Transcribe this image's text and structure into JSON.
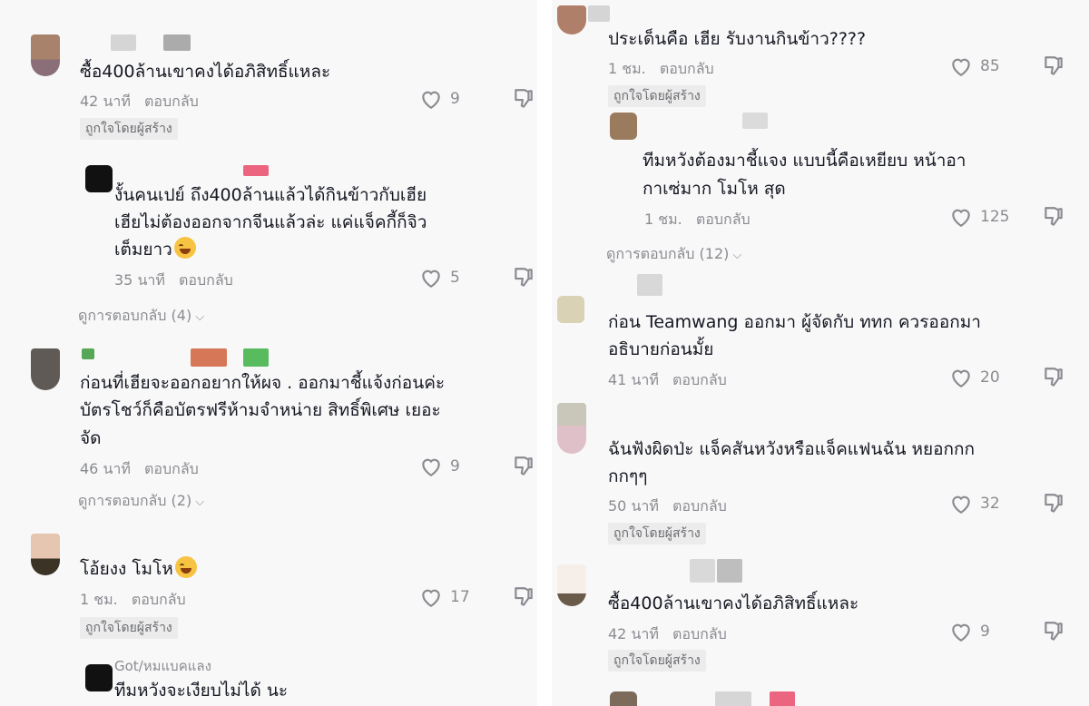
{
  "left": {
    "comments": [
      {
        "text": "ซื้อ400ล้านเขาคงได้อภิสิทธิ์แหละ",
        "time": "42 นาที",
        "reply": "ตอบกลับ",
        "likes": "9",
        "badge": "ถูกใจโดยผู้สร้าง"
      },
      {
        "lines": [
          "งั้นคนเปย์ ถึง400ล้านแล้วได้กินข้าวกับเฮีย",
          "เฮียไม่ต้องออกจากจีนแล้วล่ะ แค่แจ็คกี้ก็จิว",
          "เต็มยาว"
        ],
        "time": "35 นาที",
        "reply": "ตอบกลับ",
        "likes": "5"
      },
      {
        "lines": [
          "ก่อนที่เฮียจะออกอยากให้ผจ . ออกมาชี้แจ้งก่อนค่ะ",
          "บัตรโชว์ก็คือบัตรฟรีห้ามจำหน่าย สิทธิ์พิเศษ เยอะ",
          "จัด"
        ],
        "time": "46 นาที",
        "reply": "ตอบกลับ",
        "likes": "9"
      },
      {
        "text": "โอ้ยงง โมโห",
        "time": "1 ชม.",
        "reply": "ตอบกลับ",
        "likes": "17",
        "badge": "ถูกใจโดยผู้สร้าง"
      },
      {
        "text": "ทีมหวังจะเงียบไม่ได้ นะ",
        "username": "Got/หมแบคแลง"
      }
    ],
    "view_replies": [
      "ดูการตอบกลับ (4)",
      "ดูการตอบกลับ (2)"
    ]
  },
  "right": {
    "comments": [
      {
        "text": "ประเด็นคือ เฮีย รับงานกินข้าว????",
        "time": "1 ชม.",
        "reply": "ตอบกลับ",
        "likes": "85",
        "badge": "ถูกใจโดยผู้สร้าง"
      },
      {
        "lines": [
          "ทีมหวังต้องมาชี้แจง แบบนี้คือเหยียบ หน้าอา",
          "กาเซ่มาก โมโห สุด"
        ],
        "time": "1 ชม.",
        "reply": "ตอบกลับ",
        "likes": "125"
      },
      {
        "lines": [
          "ก่อน Teamwang ออกมา ผู้จัดกับ ททก ควรออกมา",
          "อธิบายก่อนมั้ย"
        ],
        "time": "41 นาที",
        "reply": "ตอบกลับ",
        "likes": "20"
      },
      {
        "lines": [
          "ฉันฟังผิดป่ะ แจ็คสันหวังหรือแจ็คแฟนฉัน  หยอกกก",
          "กกๆๆ"
        ],
        "time": "50 นาที",
        "reply": "ตอบกลับ",
        "likes": "32",
        "badge": "ถูกใจโดยผู้สร้าง"
      },
      {
        "text": "ซื้อ400ล้านเขาคงได้อภิสิทธิ์แหละ",
        "time": "42 นาที",
        "reply": "ตอบกลับ",
        "likes": "9",
        "badge": "ถูกใจโดยผู้สร้าง"
      }
    ],
    "view_replies": [
      "ดูการตอบกลับ (12)"
    ]
  },
  "icons": {
    "like": "heart-outline-icon",
    "dislike": "thumbs-down-icon",
    "emoji": "laughing-tears-emoji-icon",
    "chevron": "chevron-down-icon"
  },
  "colors": {
    "text": "#161823",
    "meta": "#8a8b91",
    "panel_bg": "#f8f8f8"
  }
}
